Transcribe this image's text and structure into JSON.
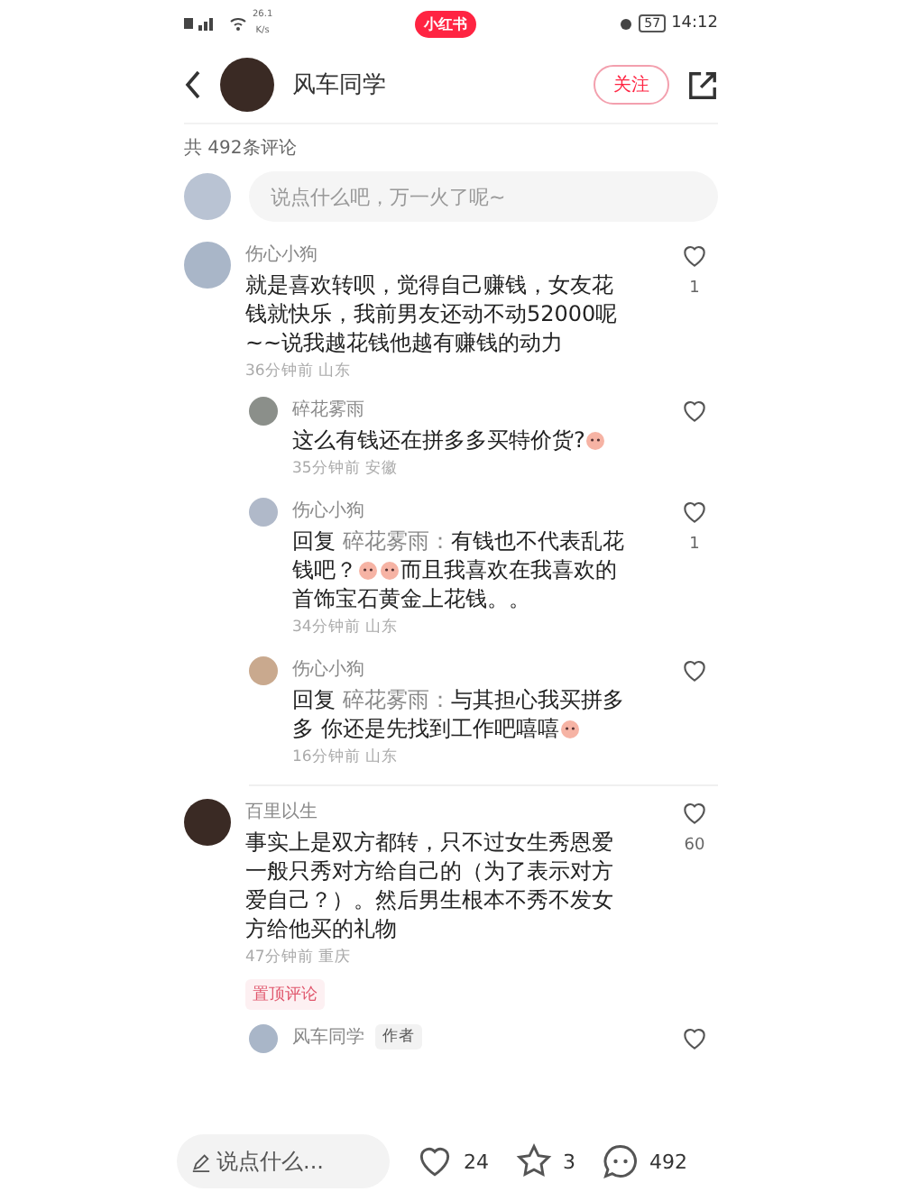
{
  "status_bar": {
    "speed": "26.1",
    "speed_unit": "K/s",
    "app_badge": "小红书",
    "battery": "57",
    "time": "14:12"
  },
  "header": {
    "author": "风车同学",
    "follow_button": "关注"
  },
  "comment_count": "共 492条评论",
  "comment_input": {
    "placeholder": "说点什么吧，万一火了呢~"
  },
  "comments": [
    {
      "user": "伤心小狗",
      "segments": [
        {
          "kind": "text",
          "text": "就是喜欢转呗，觉得自己赚钱，女友花钱就快乐，我前男友还动不动52000呢~~说我越花钱他越有赚钱的动力"
        }
      ],
      "time": "36分钟前",
      "location": "山东",
      "likes": "1",
      "replies": [
        {
          "user": "碎花雾雨",
          "segments": [
            {
              "kind": "text",
              "text": "这么有钱还在拼多多买特价货?"
            },
            {
              "kind": "emoji"
            }
          ],
          "time": "35分钟前",
          "location": "安徽"
        },
        {
          "user": "伤心小狗",
          "reply_prefix": "回复",
          "reply_to": "碎花雾雨：",
          "segments": [
            {
              "kind": "text",
              "text": "有钱也不代表乱花钱吧？"
            },
            {
              "kind": "emoji"
            },
            {
              "kind": "emoji"
            },
            {
              "kind": "text",
              "text": "而且我喜欢在我喜欢的首饰宝石黄金上花钱。。"
            }
          ],
          "time": "34分钟前",
          "location": "山东",
          "likes": "1"
        },
        {
          "user": "伤心小狗",
          "reply_prefix": "回复",
          "reply_to": "碎花雾雨：",
          "segments": [
            {
              "kind": "text",
              "text": "与其担心我买拼多多 你还是先找到工作吧嘻嘻"
            },
            {
              "kind": "emoji"
            }
          ],
          "time": "16分钟前",
          "location": "山东"
        }
      ]
    },
    {
      "user": "百里以生",
      "segments": [
        {
          "kind": "text",
          "text": "事实上是双方都转，只不过女生秀恩爱一般只秀对方给自己的（为了表示对方爱自己？）。然后男生根本不秀不发女方给他买的礼物"
        }
      ],
      "time": "47分钟前",
      "location": "重庆",
      "likes": "60",
      "pinned_tag": "置顶评论",
      "replies": [
        {
          "user": "风车同学",
          "author_tag": "作者"
        }
      ]
    }
  ],
  "bottom_bar": {
    "placeholder": "说点什么...",
    "likes": "24",
    "stars": "3",
    "comments": "492"
  }
}
